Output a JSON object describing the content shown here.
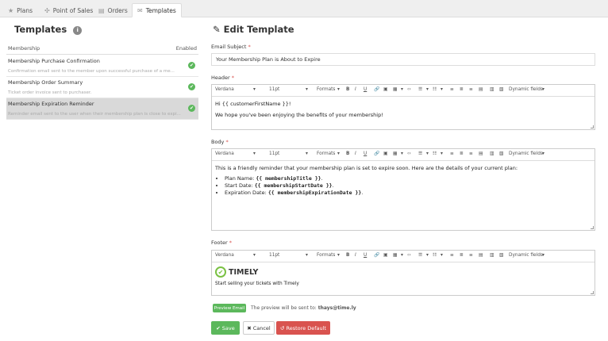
{
  "tabs": [
    {
      "icon": "★",
      "label": "Plans"
    },
    {
      "icon": "✣",
      "label": "Point of Sales"
    },
    {
      "icon": "▤",
      "label": "Orders"
    },
    {
      "icon": "✉",
      "label": "Templates"
    }
  ],
  "left": {
    "title": "Templates",
    "info_icon": "i",
    "col_membership": "Membership",
    "col_enabled": "Enabled",
    "rows": [
      {
        "title": "Membership Purchase Confirmation",
        "desc": "Confirmation email sent to the member upon successful purchase of a me..."
      },
      {
        "title": "Membership Order Summary",
        "desc": "Ticket order invoice sent to purchaser."
      },
      {
        "title": "Membership Expiration Reminder",
        "desc": "Reminder email sent to the user when their membership plan is close to expi..."
      }
    ]
  },
  "right": {
    "title": "Edit Template",
    "title_icon": "✎",
    "subject_label": "Email Subject",
    "subject_value": "Your Membership Plan is About to Expire",
    "header_label": "Header",
    "body_label": "Body",
    "footer_label": "Footer",
    "required_mark": "*",
    "toolbar": {
      "font": "Verdana",
      "size": "11pt",
      "formats": "Formats",
      "dynamic": "Dynamic fields",
      "caret": "▾",
      "bold": "B",
      "italic": "I",
      "underline": "U"
    },
    "header_content": {
      "line1": "Hi {{ customerFirstName }}!",
      "line2": "We hope you've been enjoying the benefits of your membership!"
    },
    "body_content": {
      "intro": "This is a friendly reminder that your membership plan is set to expire soon. Here are the details of your current plan:",
      "items": [
        {
          "label": "Plan Name:",
          "value": "{{ membershipTitle }}",
          "suffix": "."
        },
        {
          "label": "Start Date:",
          "value": "{{ membershipStartDate }}",
          "suffix": "."
        },
        {
          "label": "Expiration Date:",
          "value": "{{ membershipExpirationDate }}",
          "suffix": "."
        }
      ]
    },
    "footer_content": {
      "logo_text": "TIMELY",
      "tagline": "Start selling your tickets with Timely"
    },
    "preview_button": "Preview Email",
    "preview_note": "The preview will be sent to:",
    "preview_email": "thays@time.ly",
    "save_button": "Save",
    "cancel_button": "Cancel",
    "restore_button": "Restore Default"
  },
  "colors": {
    "green": "#5cb85c",
    "red": "#d9534f",
    "logo_green": "#7ac143"
  }
}
